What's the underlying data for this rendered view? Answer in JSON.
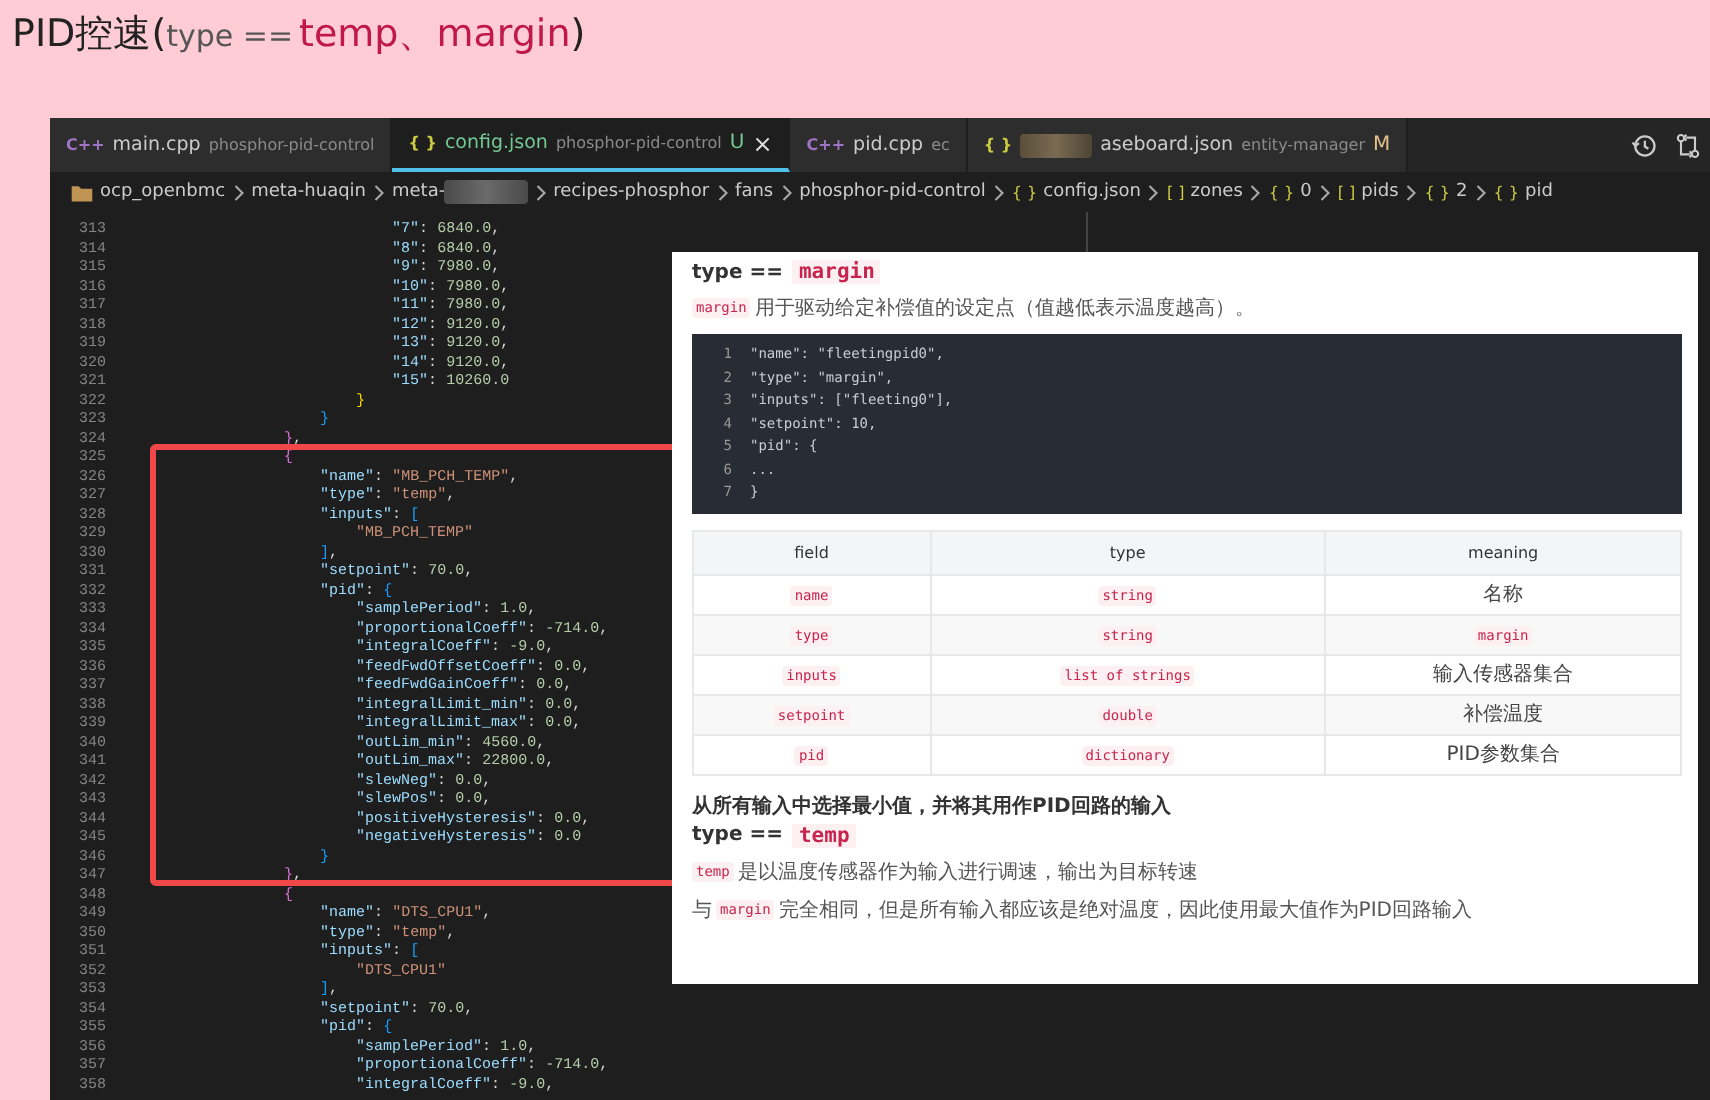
{
  "slide_title": {
    "prefix": "PID控速(",
    "type_label": "type ==",
    "values": "temp、margin",
    "suffix": ")"
  },
  "editor": {
    "tabs": [
      {
        "icon": "C++",
        "kind": "cpp",
        "name": "main.cpp",
        "detail": "phosphor-pid-control",
        "selected": false,
        "redacted": false
      },
      {
        "icon": "{ }",
        "kind": "json",
        "name": "config.json",
        "detail": "phosphor-pid-control",
        "color": "#73c991",
        "status": "U",
        "close": "×",
        "selected": true,
        "redacted": false
      },
      {
        "icon": "C++",
        "kind": "cpp",
        "name": "pid.cpp",
        "detail": "ec",
        "selected": false,
        "redacted": false
      },
      {
        "icon": "{ }",
        "kind": "json",
        "name": "aseboard.json",
        "detail": "entity-manager",
        "color": "#e2c08d",
        "status": "M",
        "selected": false,
        "redacted": true
      }
    ],
    "breadcrumbs": [
      {
        "kind": "folder",
        "label": "ocp_openbmc",
        "redacted": false
      },
      {
        "label": "meta-huaqin",
        "redacted": false
      },
      {
        "label": "meta-",
        "redacted": true
      },
      {
        "label": "recipes-phosphor",
        "redacted": false
      },
      {
        "label": "fans",
        "redacted": false
      },
      {
        "label": "phosphor-pid-control",
        "redacted": false
      },
      {
        "icon": "{ }",
        "label": "config.json",
        "redacted": false
      },
      {
        "icon": "[ ]",
        "label": "zones",
        "redacted": false
      },
      {
        "icon": "{ }",
        "label": "0",
        "redacted": false
      },
      {
        "icon": "[ ]",
        "label": "pids",
        "redacted": false
      },
      {
        "icon": "{ }",
        "label": "2",
        "redacted": false
      },
      {
        "icon": "{ }",
        "label": "pid",
        "redacted": false
      }
    ],
    "code_lines": [
      {
        "n": "313",
        "text": "                            \"7\": 6840.0,"
      },
      {
        "n": "314",
        "text": "                            \"8\": 6840.0,"
      },
      {
        "n": "315",
        "text": "                            \"9\": 7980.0,"
      },
      {
        "n": "316",
        "text": "                            \"10\": 7980.0,"
      },
      {
        "n": "317",
        "text": "                            \"11\": 7980.0,"
      },
      {
        "n": "318",
        "text": "                            \"12\": 9120.0,"
      },
      {
        "n": "319",
        "text": "                            \"13\": 9120.0,"
      },
      {
        "n": "320",
        "text": "                            \"14\": 9120.0,"
      },
      {
        "n": "321",
        "text": "                            \"15\": 10260.0"
      },
      {
        "n": "322",
        "text": "                        }"
      },
      {
        "n": "323",
        "text": "                    }"
      },
      {
        "n": "324",
        "text": "                },"
      },
      {
        "n": "325",
        "text": "                {"
      },
      {
        "n": "326",
        "text": "                    \"name\": \"MB_PCH_TEMP\","
      },
      {
        "n": "327",
        "text": "                    \"type\": \"temp\","
      },
      {
        "n": "328",
        "text": "                    \"inputs\": ["
      },
      {
        "n": "329",
        "text": "                        \"MB_PCH_TEMP\""
      },
      {
        "n": "330",
        "text": "                    ],"
      },
      {
        "n": "331",
        "text": "                    \"setpoint\": 70.0,"
      },
      {
        "n": "332",
        "text": "                    \"pid\": {"
      },
      {
        "n": "333",
        "text": "                        \"samplePeriod\": 1.0,"
      },
      {
        "n": "334",
        "text": "                        \"proportionalCoeff\": -714.0,"
      },
      {
        "n": "335",
        "text": "                        \"integralCoeff\": -9.0,"
      },
      {
        "n": "336",
        "text": "                        \"feedFwdOffsetCoeff\": 0.0,"
      },
      {
        "n": "337",
        "text": "                        \"feedFwdGainCoeff\": 0.0,"
      },
      {
        "n": "338",
        "text": "                        \"integralLimit_min\": 0.0,"
      },
      {
        "n": "339",
        "text": "                        \"integralLimit_max\": 0.0,"
      },
      {
        "n": "340",
        "text": "                        \"outLim_min\": 4560.0,"
      },
      {
        "n": "341",
        "text": "                        \"outLim_max\": 22800.0,"
      },
      {
        "n": "342",
        "text": "                        \"slewNeg\": 0.0,"
      },
      {
        "n": "343",
        "text": "                        \"slewPos\": 0.0,"
      },
      {
        "n": "344",
        "text": "                        \"positiveHysteresis\": 0.0,"
      },
      {
        "n": "345",
        "text": "                        \"negativeHysteresis\": 0.0"
      },
      {
        "n": "346",
        "text": "                    }"
      },
      {
        "n": "347",
        "text": "                },"
      },
      {
        "n": "348",
        "text": "                {"
      },
      {
        "n": "349",
        "text": "                    \"name\": \"DTS_CPU1\","
      },
      {
        "n": "350",
        "text": "                    \"type\": \"temp\","
      },
      {
        "n": "351",
        "text": "                    \"inputs\": ["
      },
      {
        "n": "352",
        "text": "                        \"DTS_CPU1\""
      },
      {
        "n": "353",
        "text": "                    ],"
      },
      {
        "n": "354",
        "text": "                    \"setpoint\": 70.0,"
      },
      {
        "n": "355",
        "text": "                    \"pid\": {"
      },
      {
        "n": "356",
        "text": "                        \"samplePeriod\": 1.0,"
      },
      {
        "n": "357",
        "text": "                        \"proportionalCoeff\": -714.0,"
      },
      {
        "n": "358",
        "text": "                        \"integralCoeff\": -9.0,"
      }
    ]
  },
  "doc_panel": {
    "heading_margin": {
      "label": "type ==",
      "code": "margin"
    },
    "margin_intro": {
      "code": "margin",
      "text": "用于驱动给定补偿值的设定点（值越低表示温度越高）。"
    },
    "code_block": [
      {
        "n": "1",
        "text": "\"name\": \"fleetingpid0\","
      },
      {
        "n": "2",
        "text": "\"type\": \"margin\","
      },
      {
        "n": "3",
        "text": "\"inputs\": [\"fleeting0\"],"
      },
      {
        "n": "4",
        "text": "\"setpoint\": 10,"
      },
      {
        "n": "5",
        "text": "\"pid\": {"
      },
      {
        "n": "6",
        "text": "..."
      },
      {
        "n": "7",
        "text": "}"
      }
    ],
    "table": {
      "columns": [
        "field",
        "type",
        "meaning"
      ],
      "rows": [
        {
          "field": "name",
          "type": "string",
          "meaning": "名称",
          "kind": "text"
        },
        {
          "field": "type",
          "type": "string",
          "meaning": "margin",
          "kind": "code"
        },
        {
          "field": "inputs",
          "type": "list of strings",
          "meaning": "输入传感器集合",
          "kind": "text"
        },
        {
          "field": "setpoint",
          "type": "double",
          "meaning": "补偿温度",
          "kind": "text"
        },
        {
          "field": "pid",
          "type": "dictionary",
          "meaning": "PID参数集合",
          "kind": "text"
        }
      ]
    },
    "min_note": "从所有输入中选择最小值，并将其用作PID回路的输入",
    "heading_temp": {
      "label": "type ==",
      "code": "temp"
    },
    "temp_intro": {
      "code": "temp",
      "text": "是以温度传感器作为输入进行调速，输出为目标转速"
    },
    "temp_note": {
      "before": "与",
      "code": "margin",
      "after": "完全相同，但是所有输入都应该是绝对温度，因此使用最大值作为PID回路输入"
    }
  }
}
